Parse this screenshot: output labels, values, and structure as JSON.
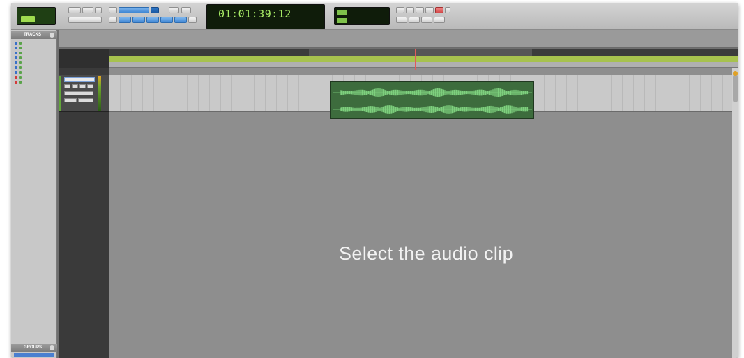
{
  "toolbar": {
    "mode_lcd": {
      "label": "",
      "button": ""
    },
    "counter": {
      "main": "01:01:39:12",
      "sub": ""
    },
    "sel_lcd": {
      "rows": [
        {
          "tag": "",
          "value": ""
        },
        {
          "tag": "",
          "value": ""
        }
      ]
    },
    "buttons": [
      "",
      "",
      "",
      "",
      "",
      "",
      "",
      "",
      "",
      "",
      "",
      "",
      ""
    ]
  },
  "tracks_panel": {
    "title": "TRACKS",
    "items": [
      "",
      "",
      "",
      "",
      "",
      "",
      "",
      "",
      ""
    ]
  },
  "groups_panel": {
    "title": "GROUPS"
  },
  "rulers": {
    "labels": [
      "",
      ""
    ],
    "ticks": [
      "",
      "",
      "",
      "",
      "",
      "",
      "",
      "",
      "",
      ""
    ]
  },
  "track": {
    "name": ""
  },
  "clip": {
    "name": ""
  },
  "instruction": "Select the audio clip",
  "colors": {
    "clip": "#3d6c3d",
    "waveform": "#7ed07e",
    "marker_row": "#a7c24e",
    "lcd_text": "#a9ee66"
  }
}
